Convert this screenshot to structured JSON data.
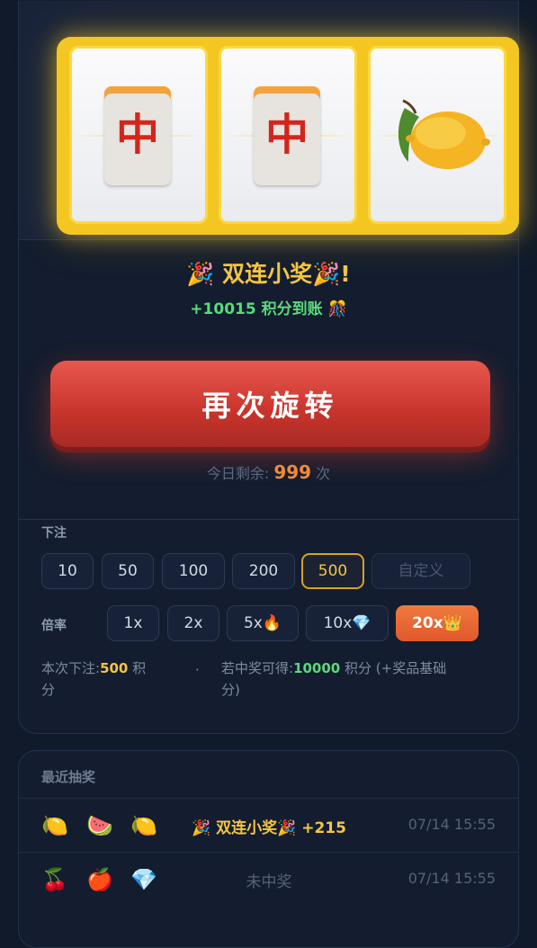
{
  "reels": {
    "symbols": [
      "中",
      "中",
      "lemon"
    ]
  },
  "result": {
    "title": "🎉 双连小奖🎉!",
    "subtitle": "+10015 积分到账 🎊"
  },
  "spin_button": {
    "label": "再次旋转"
  },
  "remaining": {
    "label": "今日剩余:",
    "count": "999",
    "unit": "次"
  },
  "bet": {
    "label": "下注",
    "options": [
      "10",
      "50",
      "100",
      "200",
      "500",
      "自定义"
    ],
    "selected": "500"
  },
  "multiplier": {
    "label": "倍率",
    "options": [
      "1x",
      "2x",
      "5x🔥",
      "10x💎",
      "20x👑"
    ],
    "selected": "20x👑"
  },
  "summary": {
    "current_bet_label": "本次下注:",
    "current_bet_value": "500",
    "current_bet_unit": "积",
    "current_bet_unit2": "分",
    "separator": "·",
    "win_label": "若中奖可得:",
    "win_value": "10000",
    "win_unit": "积分 (+奖品基础",
    "win_unit2": "分)"
  },
  "recent": {
    "title": "最近抽奖",
    "rows": [
      {
        "icons": [
          "🍋",
          "🍉",
          "🍋"
        ],
        "result": "🎉 双连小奖🎉 +215",
        "time": "07/14 15:55"
      },
      {
        "icons": [
          "🍒",
          "🍎",
          "💎"
        ],
        "result": "未中奖",
        "time": "07/14 15:55"
      }
    ]
  },
  "colors": {
    "accent_gold": "#f5c542",
    "win_green": "#5dd87a",
    "spin_red": "#d23b30",
    "multiplier_orange": "#e8662f"
  }
}
